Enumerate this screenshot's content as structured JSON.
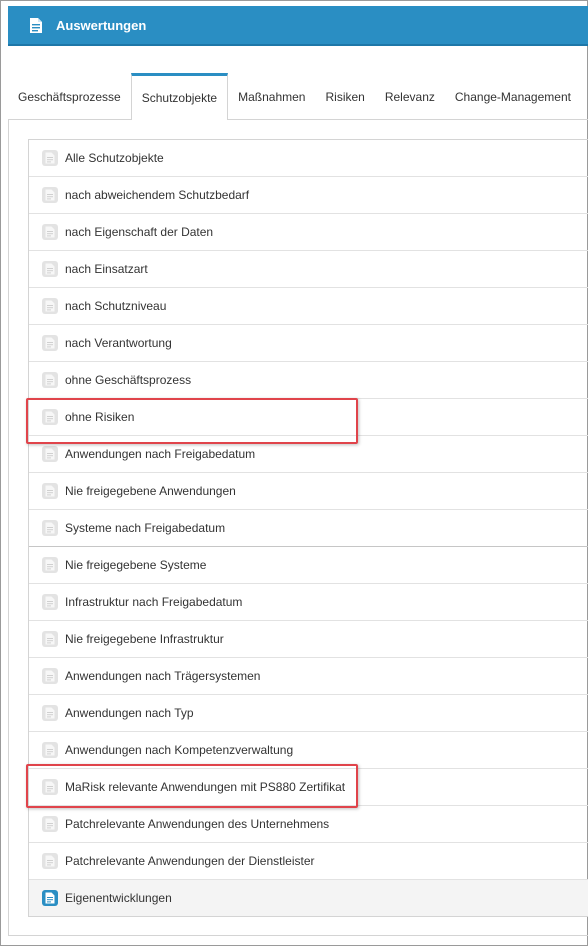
{
  "header": {
    "title": "Auswertungen",
    "accent_color": "#2a8ec3",
    "icon": "document-icon"
  },
  "tabs": [
    {
      "label": "Geschäftsprozesse",
      "active": false
    },
    {
      "label": "Schutzobjekte",
      "active": true
    },
    {
      "label": "Maßnahmen",
      "active": false
    },
    {
      "label": "Risiken",
      "active": false
    },
    {
      "label": "Relevanz",
      "active": false
    },
    {
      "label": "Change-Management",
      "active": false
    }
  ],
  "reports": [
    {
      "label": "Alle Schutzobjekte"
    },
    {
      "label": "nach abweichendem Schutzbedarf"
    },
    {
      "label": "nach Eigenschaft der Daten"
    },
    {
      "label": "nach Einsatzart"
    },
    {
      "label": "nach Schutzniveau"
    },
    {
      "label": "nach Verantwortung"
    },
    {
      "label": "ohne Geschäftsprozess"
    },
    {
      "label": "ohne Risiken",
      "marked": true
    },
    {
      "label": "Anwendungen nach Freigabedatum"
    },
    {
      "label": "Nie freigegebene Anwendungen"
    },
    {
      "label": "Systeme nach Freigabedatum"
    },
    {
      "label": "Nie freigegebene Systeme"
    },
    {
      "label": "Infrastruktur nach Freigabedatum"
    },
    {
      "label": "Nie freigegebene Infrastruktur"
    },
    {
      "label": "Anwendungen nach Trägersystemen"
    },
    {
      "label": "Anwendungen nach Typ"
    },
    {
      "label": "Anwendungen nach Kompetenzverwaltung"
    },
    {
      "label": "MaRisk relevante Anwendungen mit PS880 Zertifikat",
      "marked": true
    },
    {
      "label": "Patchrelevante Anwendungen des Unternehmens"
    },
    {
      "label": "Patchrelevante Anwendungen der Dienstleister"
    },
    {
      "label": "Eigenentwicklungen",
      "selected": true
    }
  ],
  "colors": {
    "marker": "#e0444b",
    "icon_inactive": "#e3e3e3",
    "icon_active": "#2a8ec3"
  }
}
